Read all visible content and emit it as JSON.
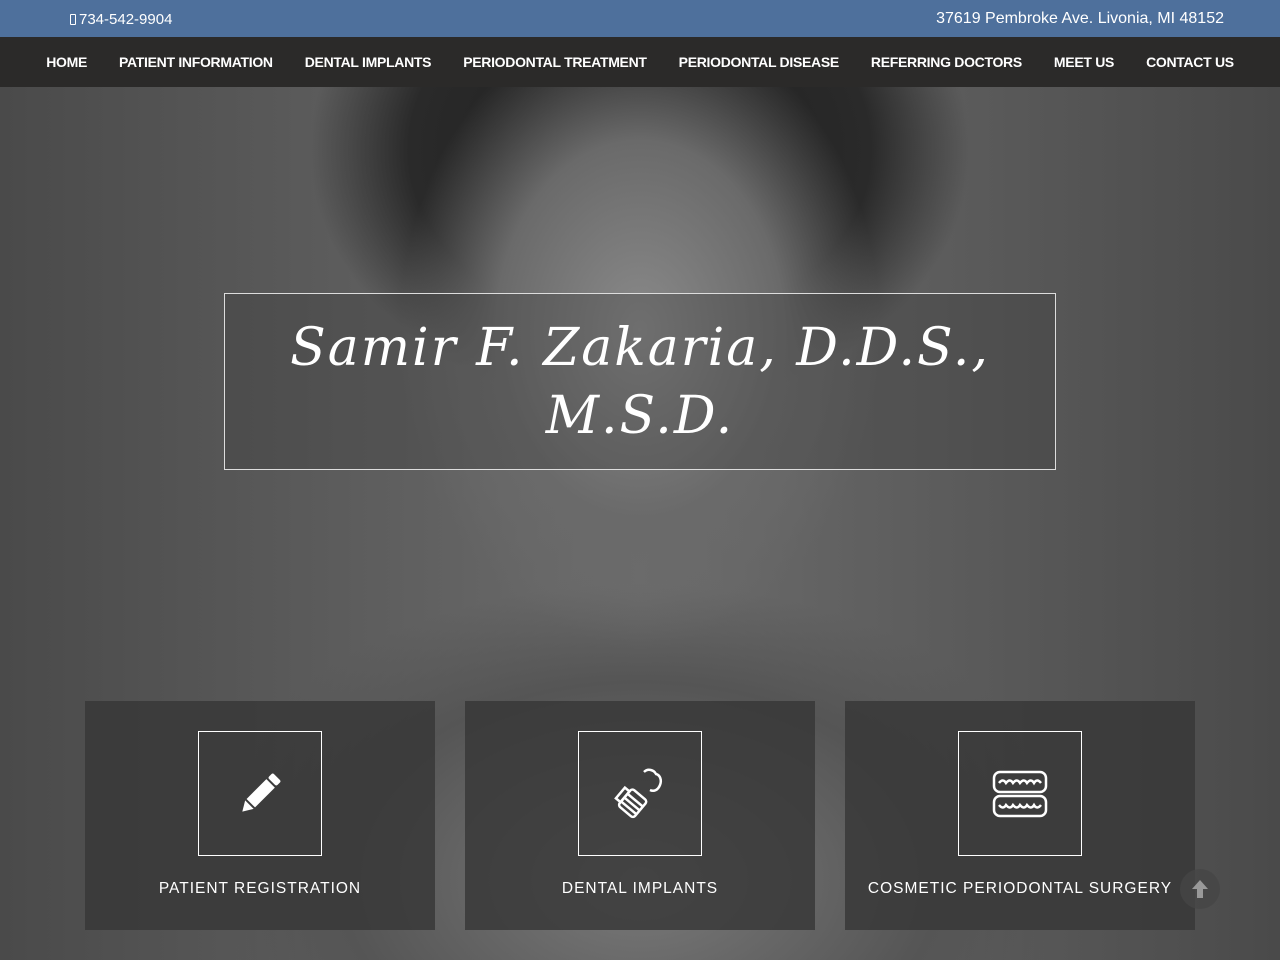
{
  "topbar": {
    "phone": "734-542-9904",
    "address": "37619 Pembroke Ave. Livonia, MI 48152",
    "background": "#4e709c"
  },
  "nav": {
    "items": [
      "HOME",
      "PATIENT INFORMATION",
      "DENTAL IMPLANTS",
      "PERIODONTAL TREATMENT",
      "PERIODONTAL DISEASE",
      "REFERRING DOCTORS",
      "MEET US",
      "CONTACT US"
    ]
  },
  "hero": {
    "title": "Samir F. Zakaria, D.D.S., M.S.D."
  },
  "cards": [
    {
      "label": "PATIENT REGISTRATION",
      "icon": "pencil-icon"
    },
    {
      "label": "DENTAL IMPLANTS",
      "icon": "dental-implant-icon"
    },
    {
      "label": "COSMETIC PERIODONTAL SURGERY",
      "icon": "dentures-icon"
    }
  ],
  "scroll_top": {
    "icon": "arrow-up-icon"
  }
}
